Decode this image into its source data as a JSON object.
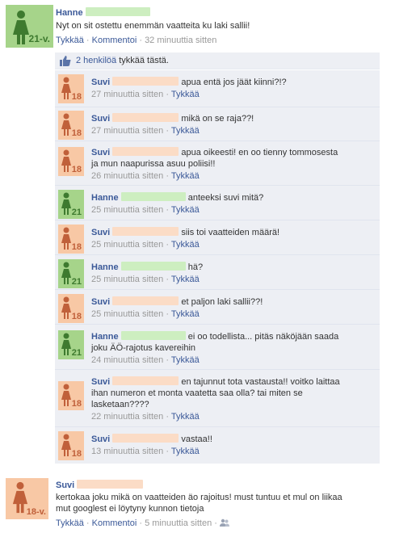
{
  "post1": {
    "author": "Hanne",
    "age_badge": "21-v.",
    "text": "Nyt on sit ostettu enemmän vaatteita ku laki sallii!",
    "like": "Tykkää",
    "comment": "Kommentoi",
    "time": "32 minuuttia sitten",
    "likes_count": "2 henkilöä",
    "likes_suffix": " tykkää tästä."
  },
  "comments": [
    {
      "author": "Suvi",
      "age": "18",
      "color": "pink",
      "text": "apua entä jos jäät kiinni?!?",
      "time": "27 minuuttia sitten",
      "like": "Tykkää"
    },
    {
      "author": "Suvi",
      "age": "18",
      "color": "pink",
      "text": "mikä on se raja??!",
      "time": "27 minuuttia sitten",
      "like": "Tykkää"
    },
    {
      "author": "Suvi",
      "age": "18",
      "color": "pink",
      "text": "apua oikeesti! en oo tienny tommosesta",
      "text2": "ja mun naapurissa asuu poliisi!!",
      "time": "26 minuuttia sitten",
      "like": "Tykkää"
    },
    {
      "author": "Hanne",
      "age": "21",
      "color": "green",
      "text": "anteeksi suvi mitä?",
      "time": "25 minuuttia sitten",
      "like": "Tykkää"
    },
    {
      "author": "Suvi",
      "age": "18",
      "color": "pink",
      "text": "siis toi vaatteiden määrä!",
      "time": "25 minuuttia sitten",
      "like": "Tykkää"
    },
    {
      "author": "Hanne",
      "age": "21",
      "color": "green",
      "text": "hä?",
      "time": "25 minuuttia sitten",
      "like": "Tykkää"
    },
    {
      "author": "Suvi",
      "age": "18",
      "color": "pink",
      "text": "et paljon laki sallii??!",
      "time": "25 minuuttia sitten",
      "like": "Tykkää"
    },
    {
      "author": "Hanne",
      "age": "21",
      "color": "green",
      "text": "ei oo todellista... pitäs näköjään saada",
      "text2": "joku ÄÖ-rajotus kavereihin",
      "time": "24 minuuttia sitten",
      "like": "Tykkää"
    },
    {
      "author": "Suvi",
      "age": "18",
      "color": "pink",
      "text": "en tajunnut tota vastausta!! voitko laittaa",
      "text2": "ihan numeron et monta vaatetta saa olla? tai miten se",
      "text3": "lasketaan????",
      "time": "22 minuuttia sitten",
      "like": "Tykkää"
    },
    {
      "author": "Suvi",
      "age": "18",
      "color": "pink",
      "text": "vastaa!!",
      "time": "13 minuuttia sitten",
      "like": "Tykkää"
    }
  ],
  "post2": {
    "author": "Suvi",
    "age_badge": "18-v.",
    "text": "kertokaa joku mikä on vaatteiden äo rajoitus! must tuntuu et mul on liikaa",
    "text2": "mut googlest ei löytyny kunnon tietoja",
    "like": "Tykkää",
    "comment": "Kommentoi",
    "time": "5 minuuttia sitten"
  },
  "colors": {
    "link": "#3b5998",
    "comment_bg": "#edeff4",
    "green_avatar": "#a6d48a",
    "pink_avatar": "#f8c8a5"
  }
}
